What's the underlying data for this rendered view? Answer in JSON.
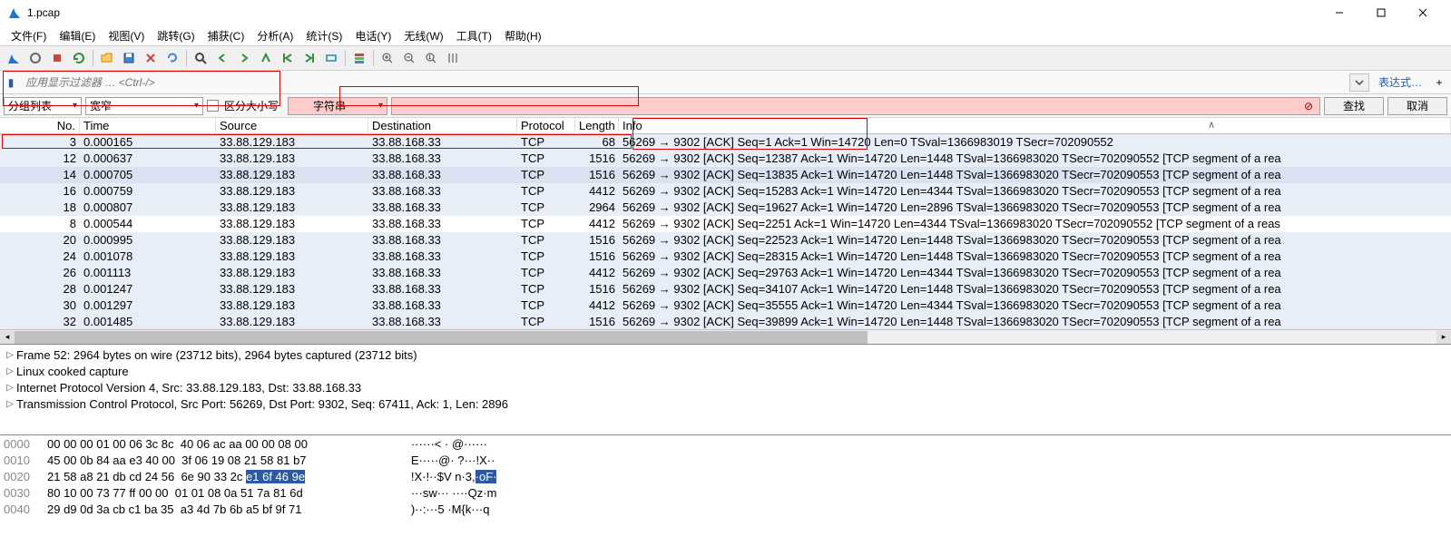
{
  "window": {
    "title": "1.pcap"
  },
  "menu": [
    {
      "label": "文件(F)"
    },
    {
      "label": "编辑(E)"
    },
    {
      "label": "视图(V)"
    },
    {
      "label": "跳转(G)"
    },
    {
      "label": "捕获(C)"
    },
    {
      "label": "分析(A)"
    },
    {
      "label": "统计(S)"
    },
    {
      "label": "电话(Y)"
    },
    {
      "label": "无线(W)"
    },
    {
      "label": "工具(T)"
    },
    {
      "label": "帮助(H)"
    }
  ],
  "filter": {
    "placeholder": "应用显示过滤器 … <Ctrl-/>",
    "expr": "表达式…"
  },
  "search": {
    "group_select": "分组列表",
    "width_select": "宽窄",
    "case_label": "区分大小写",
    "type_select": "字符串",
    "find_btn": "查找",
    "cancel_btn": "取消"
  },
  "columns": [
    "No.",
    "Time",
    "Source",
    "Destination",
    "Protocol",
    "Length",
    "Info"
  ],
  "packets": [
    {
      "no": "3",
      "time": "0.000165",
      "src": "33.88.129.183",
      "dst": "33.88.168.33",
      "proto": "TCP",
      "len": "68",
      "info": "56269 → 9302 [ACK] Seq=1 Ack=1 Win=14720 Len=0 TSval=1366983019 TSecr=702090552",
      "bg": "#e8eef8"
    },
    {
      "no": "12",
      "time": "0.000637",
      "src": "33.88.129.183",
      "dst": "33.88.168.33",
      "proto": "TCP",
      "len": "1516",
      "info": "56269 → 9302 [ACK] Seq=12387 Ack=1 Win=14720 Len=1448 TSval=1366983020 TSecr=702090552 [TCP segment of a rea",
      "bg": "#e8eef8"
    },
    {
      "no": "14",
      "time": "0.000705",
      "src": "33.88.129.183",
      "dst": "33.88.168.33",
      "proto": "TCP",
      "len": "1516",
      "info": "56269 → 9302 [ACK] Seq=13835 Ack=1 Win=14720 Len=1448 TSval=1366983020 TSecr=702090553 [TCP segment of a rea",
      "bg": "#d8e2f0"
    },
    {
      "no": "16",
      "time": "0.000759",
      "src": "33.88.129.183",
      "dst": "33.88.168.33",
      "proto": "TCP",
      "len": "4412",
      "info": "56269 → 9302 [ACK] Seq=15283 Ack=1 Win=14720 Len=4344 TSval=1366983020 TSecr=702090553 [TCP segment of a rea",
      "bg": "#e8eef8"
    },
    {
      "no": "18",
      "time": "0.000807",
      "src": "33.88.129.183",
      "dst": "33.88.168.33",
      "proto": "TCP",
      "len": "2964",
      "info": "56269 → 9302 [ACK] Seq=19627 Ack=1 Win=14720 Len=2896 TSval=1366983020 TSecr=702090553 [TCP segment of a rea",
      "bg": "#e8eef8"
    },
    {
      "no": "8",
      "time": "0.000544",
      "src": "33.88.129.183",
      "dst": "33.88.168.33",
      "proto": "TCP",
      "len": "4412",
      "info": "56269 → 9302 [ACK] Seq=2251 Ack=1 Win=14720 Len=4344 TSval=1366983020 TSecr=702090552 [TCP segment of a reas",
      "bg": "#ffffff"
    },
    {
      "no": "20",
      "time": "0.000995",
      "src": "33.88.129.183",
      "dst": "33.88.168.33",
      "proto": "TCP",
      "len": "1516",
      "info": "56269 → 9302 [ACK] Seq=22523 Ack=1 Win=14720 Len=1448 TSval=1366983020 TSecr=702090553 [TCP segment of a rea",
      "bg": "#e8eef8"
    },
    {
      "no": "24",
      "time": "0.001078",
      "src": "33.88.129.183",
      "dst": "33.88.168.33",
      "proto": "TCP",
      "len": "1516",
      "info": "56269 → 9302 [ACK] Seq=28315 Ack=1 Win=14720 Len=1448 TSval=1366983020 TSecr=702090553 [TCP segment of a rea",
      "bg": "#e8eef8"
    },
    {
      "no": "26",
      "time": "0.001113",
      "src": "33.88.129.183",
      "dst": "33.88.168.33",
      "proto": "TCP",
      "len": "4412",
      "info": "56269 → 9302 [ACK] Seq=29763 Ack=1 Win=14720 Len=4344 TSval=1366983020 TSecr=702090553 [TCP segment of a rea",
      "bg": "#e8eef8"
    },
    {
      "no": "28",
      "time": "0.001247",
      "src": "33.88.129.183",
      "dst": "33.88.168.33",
      "proto": "TCP",
      "len": "1516",
      "info": "56269 → 9302 [ACK] Seq=34107 Ack=1 Win=14720 Len=1448 TSval=1366983020 TSecr=702090553 [TCP segment of a rea",
      "bg": "#e8eef8"
    },
    {
      "no": "30",
      "time": "0.001297",
      "src": "33.88.129.183",
      "dst": "33.88.168.33",
      "proto": "TCP",
      "len": "4412",
      "info": "56269 → 9302 [ACK] Seq=35555 Ack=1 Win=14720 Len=4344 TSval=1366983020 TSecr=702090553 [TCP segment of a rea",
      "bg": "#e8eef8"
    },
    {
      "no": "32",
      "time": "0.001485",
      "src": "33.88.129.183",
      "dst": "33.88.168.33",
      "proto": "TCP",
      "len": "1516",
      "info": "56269 → 9302 [ACK] Seq=39899 Ack=1 Win=14720 Len=1448 TSval=1366983020 TSecr=702090553 [TCP segment of a rea",
      "bg": "#e8eef8"
    }
  ],
  "tree": [
    "Frame 52: 2964 bytes on wire (23712 bits), 2964 bytes captured (23712 bits)",
    "Linux cooked capture",
    "Internet Protocol Version 4, Src: 33.88.129.183, Dst: 33.88.168.33",
    "Transmission Control Protocol, Src Port: 56269, Dst Port: 9302, Seq: 67411, Ack: 1, Len: 2896"
  ],
  "hex": [
    {
      "off": "0000",
      "b": "00 00 00 01 00 06 3c 8c  40 06 ac aa 00 00 08 00",
      "a": "······< · @······"
    },
    {
      "off": "0010",
      "b": "45 00 0b 84 aa e3 40 00  3f 06 19 08 21 58 81 b7",
      "a": "E·····@· ?···!X··"
    },
    {
      "off": "0020",
      "b": "21 58 a8 21 db cd 24 56  6e 90 33 2c ",
      "a": "!X·!··$V n·3,",
      "sel_b": "e1 6f 46 9e",
      "sel_a": "·oF·"
    },
    {
      "off": "0030",
      "b": "80 10 00 73 77 ff 00 00  01 01 08 0a 51 7a 81 6d",
      "a": "···sw··· ····Qz·m"
    },
    {
      "off": "0040",
      "b": "29 d9 0d 3a cb c1 ba 35  a3 4d 7b 6b a5 bf 9f 71",
      "a": ")··:···5 ·M{k···q"
    }
  ],
  "colors": {
    "hi_bg": "#ffcccc",
    "sel_bg": "#2c5aa0"
  }
}
